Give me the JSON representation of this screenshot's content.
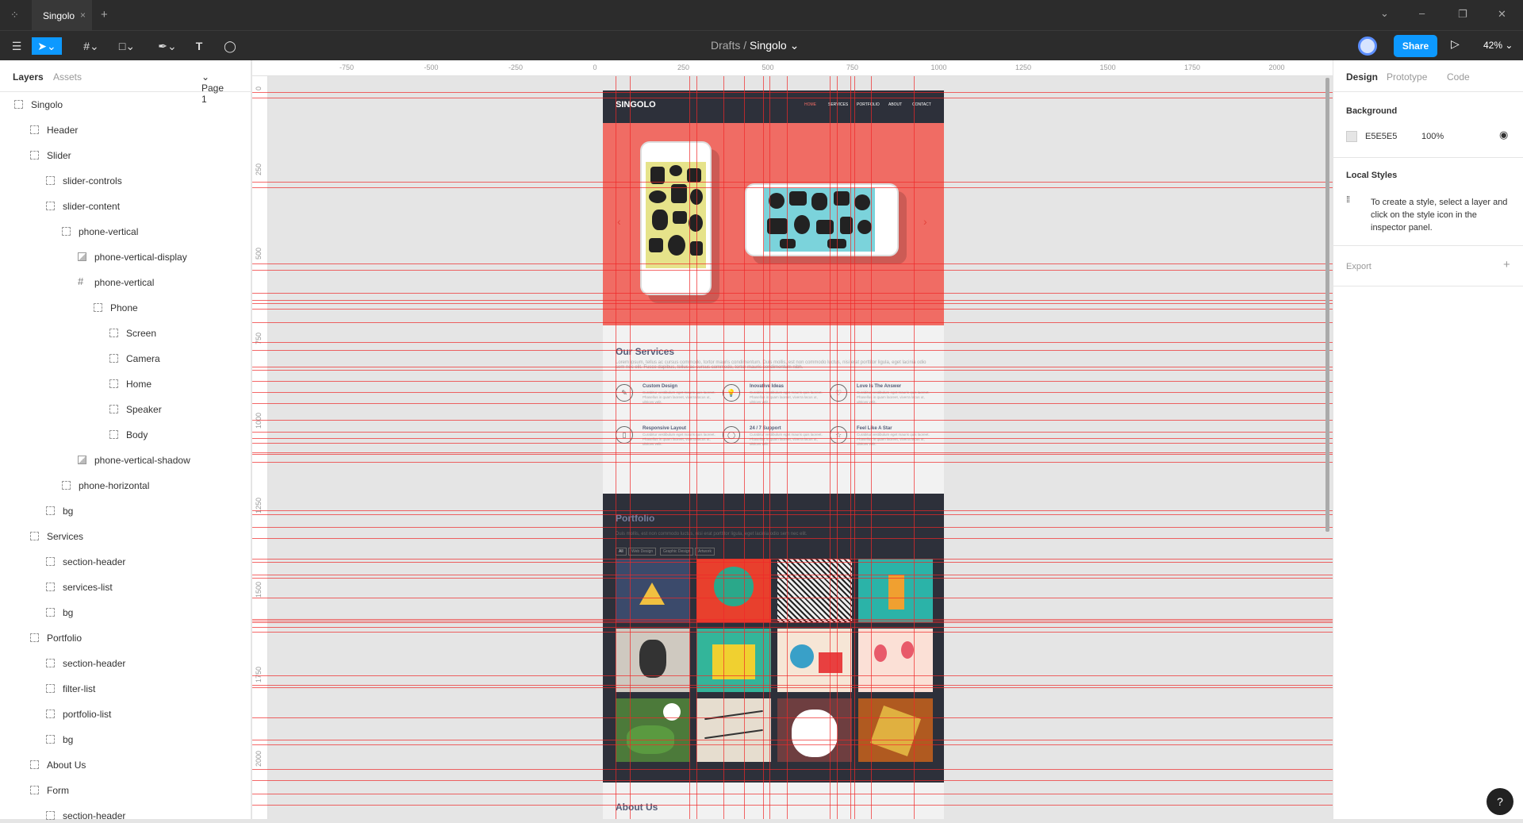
{
  "window": {
    "tab_title": "Singolo",
    "tab_close": "×",
    "new_tab": "+"
  },
  "toolbar": {
    "breadcrumb_parent": "Drafts",
    "breadcrumb_sep": "/",
    "file_name": "Singolo",
    "share_label": "Share",
    "zoom_label": "42%"
  },
  "left_panel": {
    "tab_layers": "Layers",
    "tab_assets": "Assets",
    "page_select": "Page 1",
    "layers": [
      {
        "label": "Singolo",
        "depth": 0,
        "kind": "group"
      },
      {
        "label": "Header",
        "depth": 1,
        "kind": "group"
      },
      {
        "label": "Slider",
        "depth": 1,
        "kind": "group"
      },
      {
        "label": "slider-controls",
        "depth": 2,
        "kind": "group"
      },
      {
        "label": "slider-content",
        "depth": 2,
        "kind": "group"
      },
      {
        "label": "phone-vertical",
        "depth": 3,
        "kind": "group"
      },
      {
        "label": "phone-vertical-display",
        "depth": 4,
        "kind": "image"
      },
      {
        "label": "phone-vertical",
        "depth": 4,
        "kind": "frame"
      },
      {
        "label": "Phone",
        "depth": 5,
        "kind": "group"
      },
      {
        "label": "Screen",
        "depth": 6,
        "kind": "group"
      },
      {
        "label": "Camera",
        "depth": 6,
        "kind": "group"
      },
      {
        "label": "Home",
        "depth": 6,
        "kind": "group"
      },
      {
        "label": "Speaker",
        "depth": 6,
        "kind": "group"
      },
      {
        "label": "Body",
        "depth": 6,
        "kind": "group"
      },
      {
        "label": "phone-vertical-shadow",
        "depth": 4,
        "kind": "image"
      },
      {
        "label": "phone-horizontal",
        "depth": 3,
        "kind": "group"
      },
      {
        "label": "bg",
        "depth": 2,
        "kind": "group"
      },
      {
        "label": "Services",
        "depth": 1,
        "kind": "group"
      },
      {
        "label": "section-header",
        "depth": 2,
        "kind": "group"
      },
      {
        "label": "services-list",
        "depth": 2,
        "kind": "group"
      },
      {
        "label": "bg",
        "depth": 2,
        "kind": "group"
      },
      {
        "label": "Portfolio",
        "depth": 1,
        "kind": "group"
      },
      {
        "label": "section-header",
        "depth": 2,
        "kind": "group"
      },
      {
        "label": "filter-list",
        "depth": 2,
        "kind": "group"
      },
      {
        "label": "portfolio-list",
        "depth": 2,
        "kind": "group"
      },
      {
        "label": "bg",
        "depth": 2,
        "kind": "group"
      },
      {
        "label": "About Us",
        "depth": 1,
        "kind": "group"
      },
      {
        "label": "Form",
        "depth": 1,
        "kind": "group"
      },
      {
        "label": "section-header",
        "depth": 2,
        "kind": "group"
      }
    ]
  },
  "rulers": {
    "top": [
      "-750",
      "-500",
      "-250",
      "0",
      "250",
      "500",
      "750",
      "1000",
      "1250",
      "1500",
      "1750",
      "2000"
    ],
    "left": [
      "0",
      "250",
      "500",
      "750",
      "1000",
      "1250",
      "1500",
      "1750",
      "2000"
    ]
  },
  "site": {
    "logo": "SINGOLO",
    "nav": [
      "HOME",
      "SERVICES",
      "PORTFOLIO",
      "ABOUT",
      "CONTACT"
    ],
    "arrow_left": "‹",
    "arrow_right": "›",
    "services_title": "Our Services",
    "services_text": "Lorem ipsum, tellus ac cursus commodo, tortor mauris condimentum. Duis mollis, est non commodo luctus, nisi erat porttitor ligula, eget lacinia odio sem nec elit. Fusce dapibus, tellus ac cursus commodo, tortor mauris condimentum nibh.",
    "services": [
      {
        "title": "Custom Design",
        "icon": "✎"
      },
      {
        "title": "Inovative Ideas",
        "icon": "💡"
      },
      {
        "title": "Love Is The Answer",
        "icon": "♡"
      },
      {
        "title": "Responsive Layout",
        "icon": "▯"
      },
      {
        "title": "24 / 7 Support",
        "icon": "◯"
      },
      {
        "title": "Feel Like A Star",
        "icon": "☆"
      }
    ],
    "service_desc": "Curabitur vestibulum eget mauris quis laoreet. Phasellus in quam laoreet, viverra lacus ut, ultrices velit.",
    "portfolio_title": "Portfolio",
    "portfolio_text": "Duis mollis, est non commodo luctus, nisi erat porttitor ligula, eget lacinia odio sem nec elit.",
    "filters": [
      "All",
      "Web Design",
      "Graphic Design",
      "Artwork"
    ],
    "about_title": "About Us"
  },
  "right_panel": {
    "tab_design": "Design",
    "tab_prototype": "Prototype",
    "tab_code": "Code",
    "background_title": "Background",
    "bg_hex": "E5E5E5",
    "bg_opacity": "100%",
    "local_styles_title": "Local Styles",
    "local_styles_text": "To create a style, select a layer and click on the style icon in the inspector panel.",
    "export_title": "Export",
    "export_add": "+"
  },
  "help_label": "?",
  "colors": {
    "accent": "#0d99ff",
    "slider_bg": "#f06c64",
    "dark_bg": "#2d303a",
    "guide": "#f02828"
  }
}
